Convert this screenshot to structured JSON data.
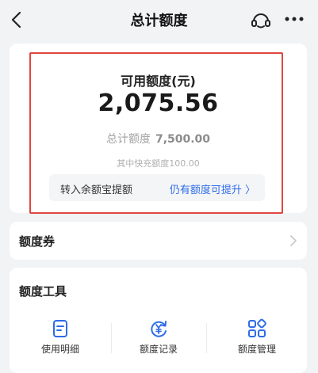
{
  "nav": {
    "title": "总计额度",
    "back_icon": "chevron-left-icon",
    "service_icon": "headset-icon",
    "more_icon": "more-dots-icon"
  },
  "quota": {
    "label": "可用额度(元)",
    "amount": "2,075.56",
    "total_label": "总计额度",
    "total_value": "7,500.00",
    "quick_note": "其中快充额度100.00",
    "transfer_label": "转入余额宝提额",
    "raise_link": "仍有额度可提升 〉"
  },
  "coupon": {
    "label": "额度券"
  },
  "tools": {
    "title": "额度工具",
    "items": [
      {
        "label": "使用明细",
        "icon": "detail-list-icon"
      },
      {
        "label": "额度记录",
        "icon": "yuan-record-icon"
      },
      {
        "label": "额度管理",
        "icon": "grid-manage-icon"
      }
    ]
  },
  "colors": {
    "accent_blue": "#2d6ce9",
    "highlight_red": "#e0463f",
    "background": "#f2f3f5"
  }
}
